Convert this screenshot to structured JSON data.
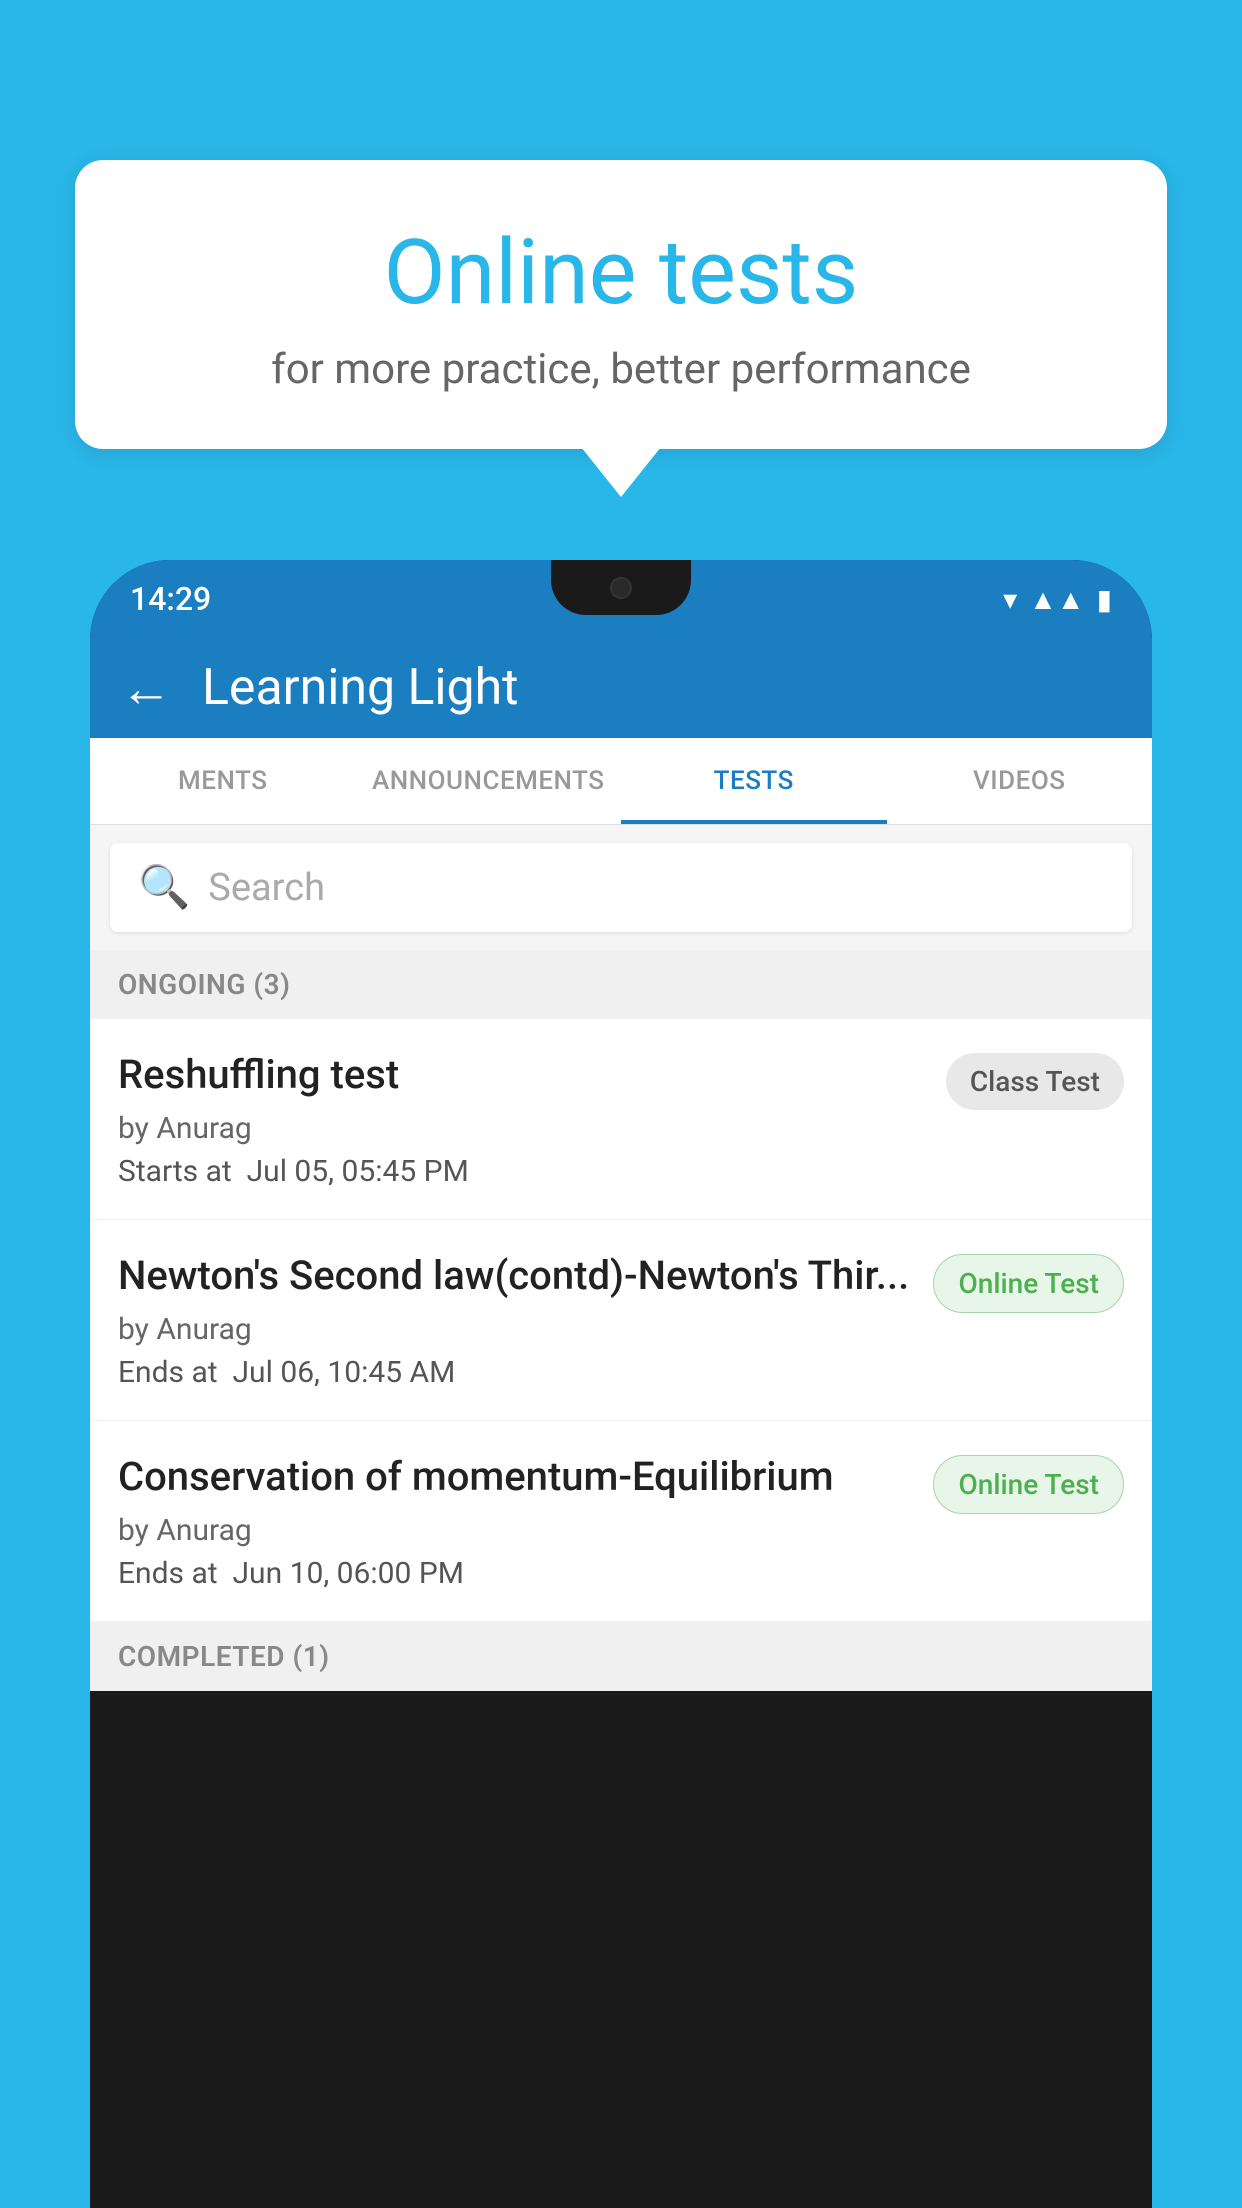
{
  "background_color": "#29b6e8",
  "bubble": {
    "title": "Online tests",
    "subtitle": "for more practice, better performance"
  },
  "phone": {
    "status_bar": {
      "time": "14:29",
      "icons": [
        "wifi",
        "signal",
        "battery"
      ]
    },
    "header": {
      "title": "Learning Light",
      "back_label": "←"
    },
    "tabs": [
      {
        "id": "ments",
        "label": "MENTS",
        "active": false
      },
      {
        "id": "announcements",
        "label": "ANNOUNCEMENTS",
        "active": false
      },
      {
        "id": "tests",
        "label": "TESTS",
        "active": true
      },
      {
        "id": "videos",
        "label": "VIDEOS",
        "active": false
      }
    ],
    "search": {
      "placeholder": "Search"
    },
    "sections": [
      {
        "id": "ongoing",
        "label": "ONGOING (3)",
        "items": [
          {
            "name": "Reshuffling test",
            "author": "by Anurag",
            "time_label": "Starts at",
            "time_value": "Jul 05, 05:45 PM",
            "badge": "Class Test",
            "badge_type": "class"
          },
          {
            "name": "Newton's Second law(contd)-Newton's Thir...",
            "author": "by Anurag",
            "time_label": "Ends at",
            "time_value": "Jul 06, 10:45 AM",
            "badge": "Online Test",
            "badge_type": "online"
          },
          {
            "name": "Conservation of momentum-Equilibrium",
            "author": "by Anurag",
            "time_label": "Ends at",
            "time_value": "Jun 10, 06:00 PM",
            "badge": "Online Test",
            "badge_type": "online"
          }
        ]
      },
      {
        "id": "completed",
        "label": "COMPLETED (1)",
        "items": []
      }
    ]
  }
}
